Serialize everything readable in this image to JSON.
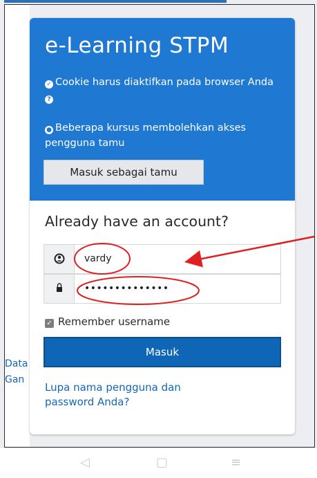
{
  "site_title": "e-Learning STPM",
  "notices": [
    {
      "icon": "check-circle-icon",
      "text": "Cookie harus diaktifkan pada browser Anda"
    },
    {
      "icon": "user-circle-icon",
      "text": "Beberapa kursus membolehkan akses pengguna tamu"
    }
  ],
  "guest_button": "Masuk sebagai tamu",
  "login": {
    "heading": "Already have an account?",
    "username_value": "vardy",
    "password_value": "••••••••••••••",
    "remember_label": "Remember username",
    "remember_checked": true,
    "submit_label": "Masuk",
    "forgot_link": "Lupa nama pengguna dan password Anda?"
  },
  "background_text": {
    "line1": "Data",
    "line2": "Gan"
  },
  "annotation_color": "#e02020",
  "colors": {
    "header": "#1f79d2",
    "button": "#0f66b6",
    "link": "#1466b8"
  }
}
